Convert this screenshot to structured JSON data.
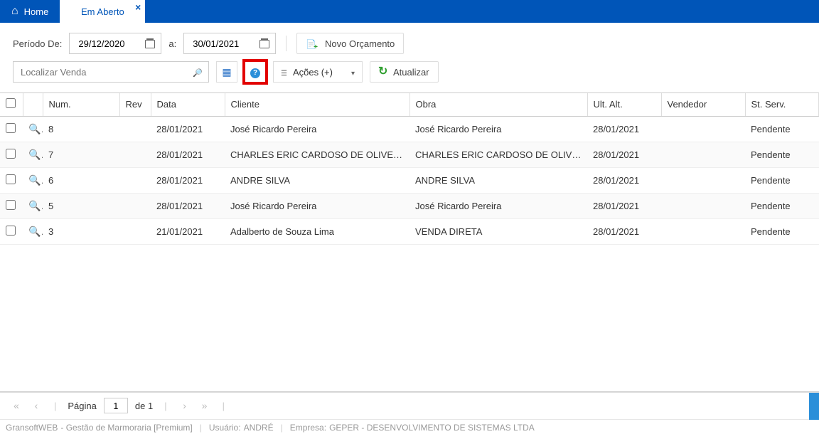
{
  "tabs": {
    "home": "Home",
    "open": "Em Aberto"
  },
  "toolbar": {
    "period_from_label": "Período De:",
    "period_from": "29/12/2020",
    "to_label": "a:",
    "period_to": "30/01/2021",
    "new_budget": "Novo Orçamento",
    "search_placeholder": "Localizar Venda",
    "actions_label": "Ações (+)",
    "refresh_label": "Atualizar"
  },
  "columns": {
    "num": "Num.",
    "rev": "Rev",
    "data": "Data",
    "cliente": "Cliente",
    "obra": "Obra",
    "ult_alt": "Ult. Alt.",
    "vendedor": "Vendedor",
    "st_serv": "St. Serv."
  },
  "rows": [
    {
      "num": "8",
      "rev": "",
      "data": "28/01/2021",
      "cliente": "José Ricardo Pereira",
      "obra": "José Ricardo Pereira",
      "ult": "28/01/2021",
      "vend": "",
      "st": "Pendente"
    },
    {
      "num": "7",
      "rev": "",
      "data": "28/01/2021",
      "cliente": "CHARLES ERIC CARDOSO DE OLIVEIRA ...",
      "obra": "CHARLES ERIC CARDOSO DE OLIVEIRA ...",
      "ult": "28/01/2021",
      "vend": "",
      "st": "Pendente"
    },
    {
      "num": "6",
      "rev": "",
      "data": "28/01/2021",
      "cliente": "ANDRE SILVA",
      "obra": "ANDRE SILVA",
      "ult": "28/01/2021",
      "vend": "",
      "st": "Pendente"
    },
    {
      "num": "5",
      "rev": "",
      "data": "28/01/2021",
      "cliente": "José Ricardo Pereira",
      "obra": "José Ricardo Pereira",
      "ult": "28/01/2021",
      "vend": "",
      "st": "Pendente"
    },
    {
      "num": "3",
      "rev": "",
      "data": "21/01/2021",
      "cliente": "Adalberto de Souza Lima",
      "obra": "VENDA DIRETA",
      "ult": "28/01/2021",
      "vend": "",
      "st": "Pendente"
    }
  ],
  "pager": {
    "page_label": "Página",
    "page": "1",
    "of_label": "de 1"
  },
  "status": {
    "app": "GransoftWEB",
    "app_desc": " - Gestão de Marmoraria [Premium]",
    "user_label": "Usuário:",
    "user": "ANDRÉ",
    "company_label": "Empresa:",
    "company": "GEPER - DESENVOLVIMENTO DE SISTEMAS LTDA"
  }
}
